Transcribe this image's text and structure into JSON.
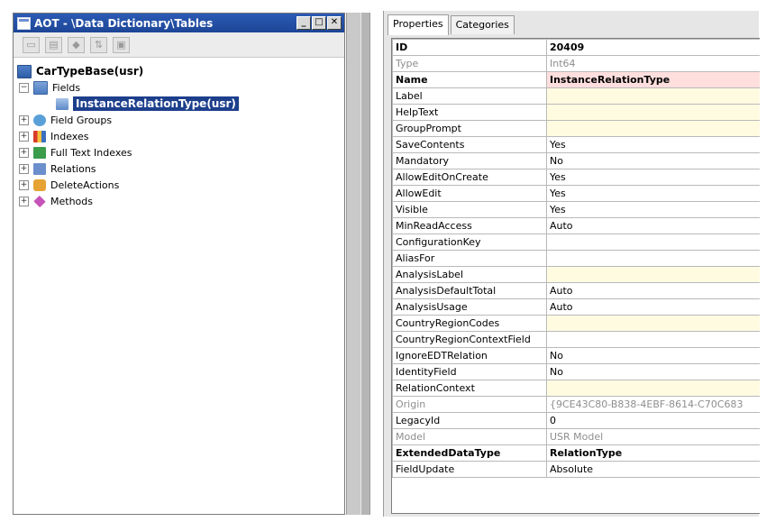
{
  "aot": {
    "title": "AOT - \\Data Dictionary\\Tables",
    "window_buttons": [
      "_",
      "□",
      "✕"
    ],
    "toolbar_icons": [
      "open-icon",
      "properties-icon",
      "compile-icon",
      "sort-icon",
      "save-icon"
    ],
    "tree": {
      "root": "CarTypeBase(usr)",
      "fields": "Fields",
      "selected_field": "InstanceRelationType(usr)",
      "nodes": [
        "Field Groups",
        "Indexes",
        "Full Text Indexes",
        "Relations",
        "DeleteActions",
        "Methods"
      ]
    }
  },
  "properties": {
    "tabs": [
      "Properties",
      "Categories"
    ],
    "rows": [
      {
        "key": "ID",
        "value": "20409"
      },
      {
        "key": "Type",
        "value": "Int64"
      },
      {
        "key": "Name",
        "value": "InstanceRelationType"
      },
      {
        "key": "Label",
        "value": ""
      },
      {
        "key": "HelpText",
        "value": ""
      },
      {
        "key": "GroupPrompt",
        "value": ""
      },
      {
        "key": "SaveContents",
        "value": "Yes"
      },
      {
        "key": "Mandatory",
        "value": "No"
      },
      {
        "key": "AllowEditOnCreate",
        "value": "Yes"
      },
      {
        "key": "AllowEdit",
        "value": "Yes"
      },
      {
        "key": "Visible",
        "value": "Yes"
      },
      {
        "key": "MinReadAccess",
        "value": "Auto"
      },
      {
        "key": "ConfigurationKey",
        "value": ""
      },
      {
        "key": "AliasFor",
        "value": ""
      },
      {
        "key": "AnalysisLabel",
        "value": ""
      },
      {
        "key": "AnalysisDefaultTotal",
        "value": "Auto"
      },
      {
        "key": "AnalysisUsage",
        "value": "Auto"
      },
      {
        "key": "CountryRegionCodes",
        "value": ""
      },
      {
        "key": "CountryRegionContextField",
        "value": ""
      },
      {
        "key": "IgnoreEDTRelation",
        "value": "No"
      },
      {
        "key": "IdentityField",
        "value": "No"
      },
      {
        "key": "RelationContext",
        "value": ""
      },
      {
        "key": "Origin",
        "value": "{9CE43C80-B838-4EBF-8614-C70C683"
      },
      {
        "key": "LegacyId",
        "value": "0"
      },
      {
        "key": "Model",
        "value": "USR Model"
      },
      {
        "key": "ExtendedDataType",
        "value": "RelationType"
      },
      {
        "key": "FieldUpdate",
        "value": "Absolute"
      }
    ]
  },
  "colors": {
    "title_bar": "#1d4596",
    "selection": "#1d3f8c",
    "editable_cell": "#fffbe1",
    "name_cell": "#ffdede"
  }
}
